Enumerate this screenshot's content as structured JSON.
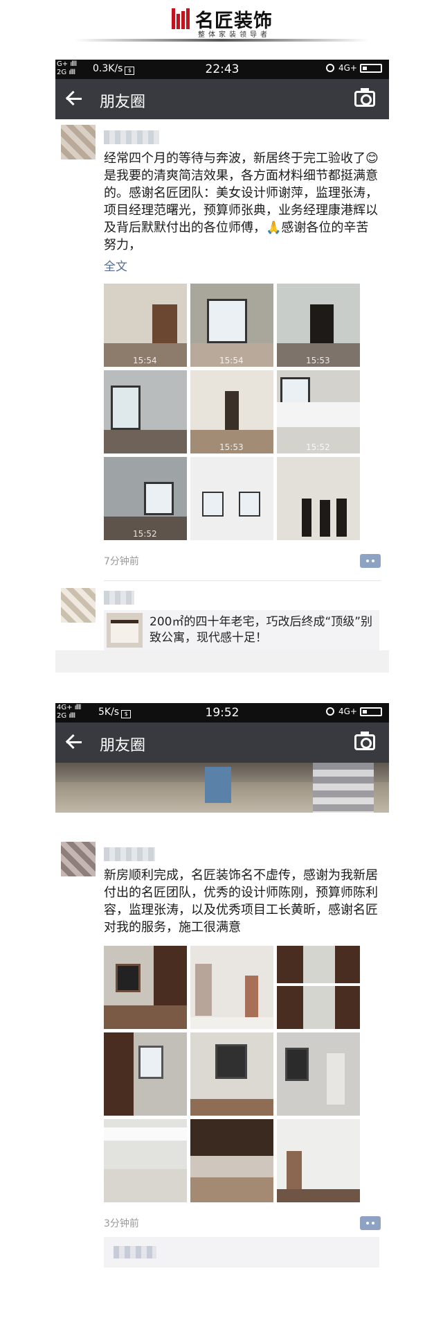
{
  "brand": {
    "name": "名匠装饰",
    "slogan": "整体家装领导者",
    "accent": "#c0151e"
  },
  "screens": [
    {
      "status": {
        "network_left_top": "G+",
        "network_left_bottom": "2G",
        "speed": "0.3K/s",
        "time": "22:43",
        "network_right": "4G+"
      },
      "nav": {
        "title": "朋友圈"
      },
      "post": {
        "text": "经常四个月的等待与奔波，新居终于完工验收了😊是我要的清爽简洁效果，各方面材料细节都挺满意的。感谢名匠团队：美女设计师谢萍，监理张涛，项目经理范曙光，预算师张典，业务经理康港辉以及背后默默付出的各位师傅，🙏感谢各位的辛苦努力，",
        "more": "全文",
        "photo_times": [
          "15:54",
          "15:54",
          "15:53",
          "",
          "15:53",
          "15:52",
          "15:52",
          "",
          ""
        ],
        "posted_ago": "7分钟前"
      },
      "next_post": {
        "share_text": "200㎡的四十年老宅，巧改后终成“顶级”别致公寓，现代感十足！"
      }
    },
    {
      "status": {
        "network_left_top": "4G+",
        "network_left_bottom": "2G",
        "speed": "5K/s",
        "time": "19:52",
        "network_right": "4G+"
      },
      "nav": {
        "title": "朋友圈"
      },
      "post": {
        "text": "新房顺利完成，名匠装饰名不虚传，感谢为我新居付出的名匠团队，优秀的设计师陈刚，预算师陈利容，监理张涛，以及优秀项目工长黄昕，感谢名匠对我的服务，施工很满意",
        "posted_ago": "3分钟前"
      }
    }
  ]
}
